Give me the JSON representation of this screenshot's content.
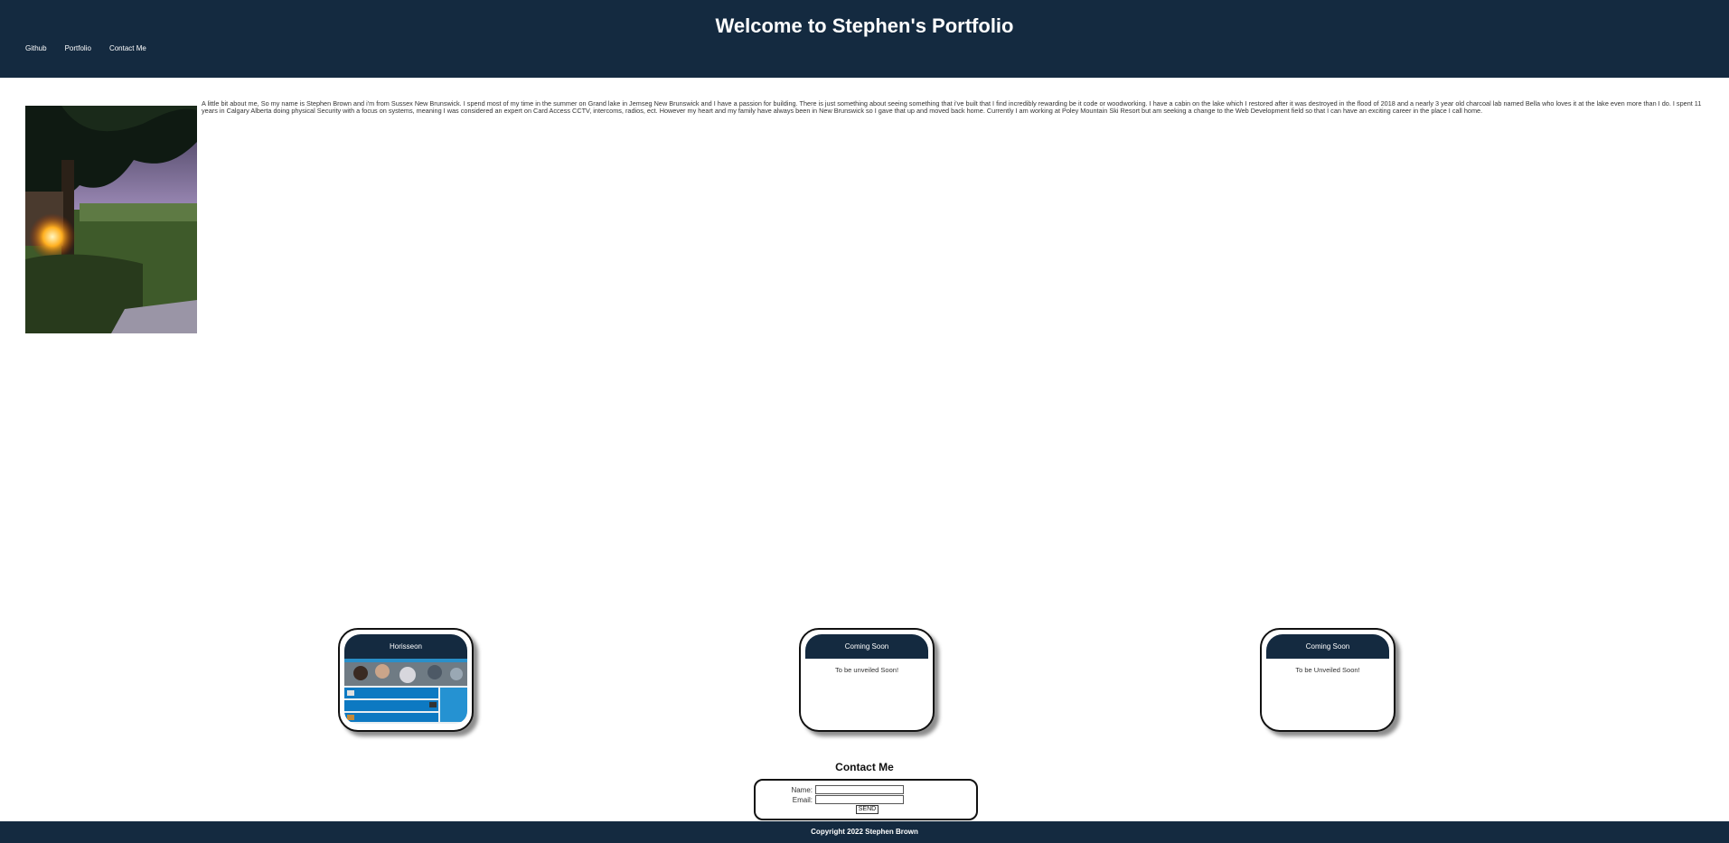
{
  "header": {
    "title": "Welcome to Stephen's Portfolio",
    "nav": [
      "Github",
      "Portfolio",
      "Contact Me"
    ]
  },
  "about": {
    "text": "A little bit about me, So my name is Stephen Brown and i'm from Sussex New Brunswick. I spend most of my time in the summer on Grand lake in Jemseg New Brunswick and I have a passion for building. There is just something about seeing something that i've built that I find incredibly rewarding be it code or woodworking. I have a cabin on the lake which I restored after it was destroyed in the flood of 2018 and a nearly 3 year old charcoal lab named Bella who loves it at the lake even more than I do. I spent 11 years in Calgary Alberta doing physical Security with a focus on systems, meaning I was considered an expert on Card Access CCTV, intercoms, radios, ect. However my heart and my family have always been in New Brunswick so I gave that up and moved back home. Currently I am working at Poley Mountain Ski Resort but am seeking a change to the Web Development field so that I can have an exciting career in the place I call home."
  },
  "projects": [
    {
      "title": "Horisseon"
    },
    {
      "title": "Coming Soon",
      "body": "To be unveiled Soon!"
    },
    {
      "title": "Coming Soon",
      "body": "To be Unveiled Soon!"
    }
  ],
  "contact": {
    "title": "Contact Me",
    "name_label": "Name:",
    "email_label": "Email:",
    "send_label": "SEND"
  },
  "footer": {
    "text": "Copyright 2022 Stephen Brown"
  },
  "colors": {
    "header_bg": "#142a40",
    "footer_bg": "#142a40"
  }
}
